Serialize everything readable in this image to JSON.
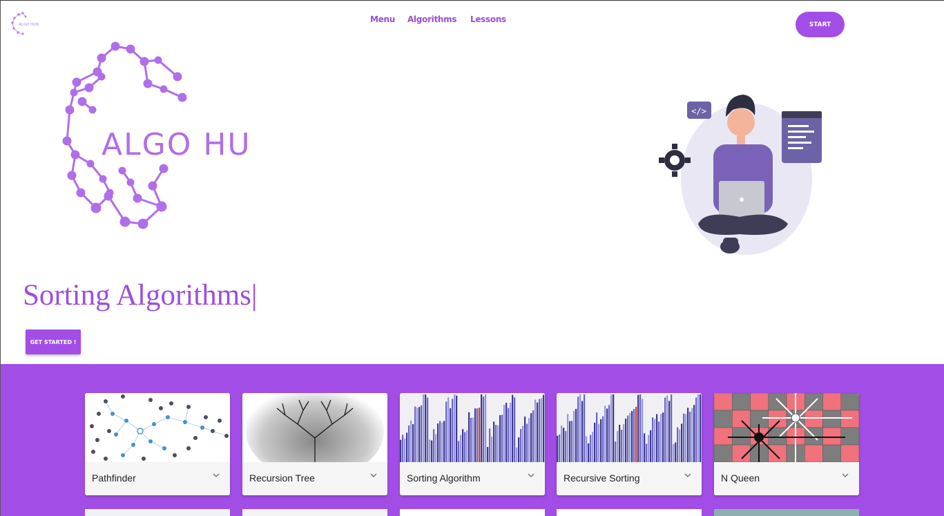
{
  "brand": {
    "logo_text": "ALGO HUB"
  },
  "nav": {
    "items": [
      "Menu",
      "Algorithms",
      "Lessons"
    ],
    "start": "START"
  },
  "hero": {
    "typed_text": "Sorting Algorithms|",
    "cta": "GET STARTED !"
  },
  "cards": [
    {
      "title": "Pathfinder"
    },
    {
      "title": "Recursion Tree"
    },
    {
      "title": "Sorting Algorithm"
    },
    {
      "title": "Recursive Sorting"
    },
    {
      "title": "N Queen"
    }
  ],
  "colors": {
    "accent": "#a24ee6",
    "nav_text": "#9b4ddb",
    "typed_text": "#9d4edd"
  },
  "icons": [
    "chevron-down-icon",
    "code-icon",
    "gear-icon",
    "window-icon"
  ]
}
